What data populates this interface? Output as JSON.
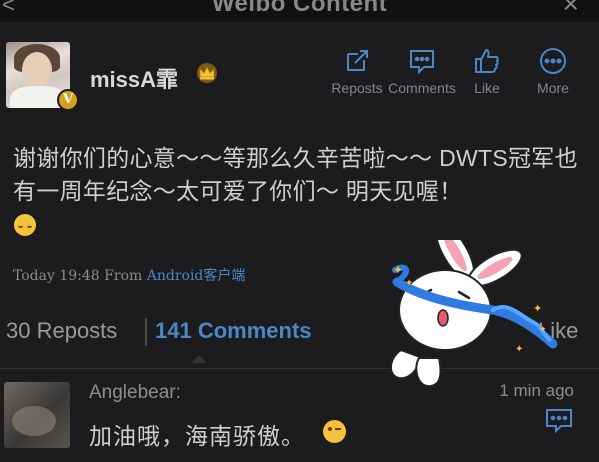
{
  "header": {
    "title": "Weibo Content",
    "back_glyph": "<",
    "close_glyph": "×"
  },
  "post": {
    "author": "missA霏",
    "verified_badge": "V",
    "text": "谢谢你们的心意～～等那么久辛苦啦～～ DWTS冠军也有一周年纪念～太可爱了你们～ 明天见喔！",
    "time": "Today 19:48",
    "from_label": "From",
    "source": "Android客户端"
  },
  "actions": [
    {
      "label": "Reposts",
      "icon": "repost-icon"
    },
    {
      "label": "Comments",
      "icon": "comment-icon"
    },
    {
      "label": "Like",
      "icon": "thumbs-up-icon"
    },
    {
      "label": "More",
      "icon": "more-icon"
    }
  ],
  "tabs": {
    "reposts": "30 Reposts",
    "comments": "141 Comments",
    "likes": "Like"
  },
  "comments": [
    {
      "user": "Anglebear:",
      "time": "1 min ago",
      "text": "加油哦，海南骄傲。"
    }
  ],
  "colors": {
    "accent": "#4b87c7",
    "background": "#1c1c1e",
    "badge": "#d4a21a"
  }
}
